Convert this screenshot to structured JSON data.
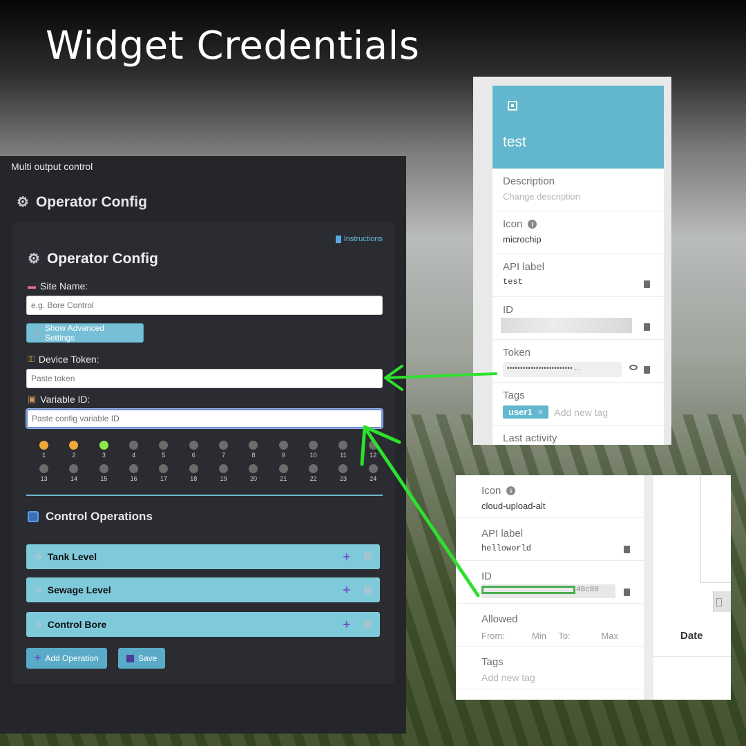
{
  "title": "Widget Credentials",
  "left": {
    "header": "Multi output control",
    "panel_title": "Operator Config",
    "instructions_label": "Instructions",
    "card_title": "Operator Config",
    "site_name_label": "Site Name:",
    "site_name_placeholder": "e.g. Bore Control",
    "advanced_button": "Show Advanced Settings",
    "device_token_label": "Device Token:",
    "device_token_placeholder": "Paste token",
    "variable_id_label": "Variable ID:",
    "variable_id_placeholder": "Paste config variable ID",
    "outputs_row1": [
      "1",
      "2",
      "3",
      "4",
      "5",
      "6",
      "7",
      "8",
      "9",
      "10",
      "11",
      "12"
    ],
    "outputs_row2": [
      "13",
      "14",
      "15",
      "16",
      "17",
      "18",
      "19",
      "20",
      "21",
      "22",
      "23",
      "24"
    ],
    "output_states": {
      "1": "orange",
      "2": "orange",
      "3": "green"
    },
    "control_ops_title": "Control Operations",
    "operations": [
      "Tank Level",
      "Sewage Level",
      "Control Bore"
    ],
    "add_operation_button": "Add Operation",
    "save_button": "Save"
  },
  "device_card": {
    "name": "test",
    "description_label": "Description",
    "description_placeholder": "Change description",
    "icon_label": "Icon",
    "icon_value": "microchip",
    "api_label_label": "API label",
    "api_label_value": "test",
    "id_label": "ID",
    "token_label": "Token",
    "token_value": "••••••••••••••••••••••••• ...",
    "tags_label": "Tags",
    "tag": "user1",
    "add_tag_placeholder": "Add new tag",
    "last_activity_label": "Last activity",
    "header_color": "#62b7ce"
  },
  "variable_card": {
    "icon_label": "Icon",
    "icon_value": "cloud-upload-alt",
    "api_label_label": "API label",
    "api_label_value": "helloworld",
    "id_label": "ID",
    "id_tail": "48c80",
    "allowed_label": "Allowed",
    "from_label": "From:",
    "min_label": "Min",
    "to_label": "To:",
    "max_label": "Max",
    "tags_label": "Tags",
    "add_tag_placeholder": "Add new tag",
    "date_header": "Date"
  },
  "colors": {
    "accent": "#62b7ce",
    "arrow": "#2ee02e",
    "panel_bg": "#25262a"
  }
}
